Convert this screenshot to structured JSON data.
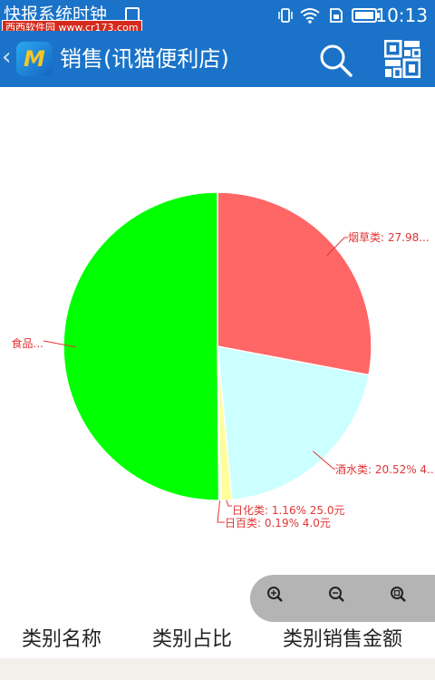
{
  "status_bar": {
    "notification_text": "快报系统时钟",
    "time": "10:13",
    "icons": [
      "image-icon",
      "vibrate-icon",
      "wifi-icon",
      "sim-icon",
      "battery-icon"
    ]
  },
  "watermark": {
    "text": "西西软件园 www.cr173.com"
  },
  "app_bar": {
    "back_glyph": "‹",
    "logo_letter": "M",
    "title": "销售(讯猫便利店)",
    "icons": [
      "search-icon",
      "qr-code-icon"
    ]
  },
  "chart_data": {
    "type": "pie",
    "slices": [
      {
        "name": "烟草类",
        "percent": 27.98,
        "color": "#ff6666",
        "label": "烟草类: 27.98..."
      },
      {
        "name": "酒水类",
        "percent": 20.52,
        "color": "#ccffff",
        "label": "酒水类: 20.52% 4..."
      },
      {
        "name": "日化类",
        "percent": 1.16,
        "value": 25.0,
        "color": "#ffff99",
        "label": "日化类: 1.16% 25.0元"
      },
      {
        "name": "日百类",
        "percent": 0.19,
        "value": 4.0,
        "color": "#e8e8a8",
        "label": "日百类: 0.19% 4.0元"
      },
      {
        "name": "食品",
        "percent": 50.15,
        "color": "#00ff00",
        "label": "食品..."
      }
    ],
    "label_color": "#e23535",
    "legend": "none"
  },
  "zoom_controls": {
    "icons": [
      "zoom-in-icon",
      "zoom-out-icon",
      "zoom-reset-icon"
    ]
  },
  "table_headers": [
    "类别名称",
    "类别占比",
    "类别销售金额"
  ]
}
